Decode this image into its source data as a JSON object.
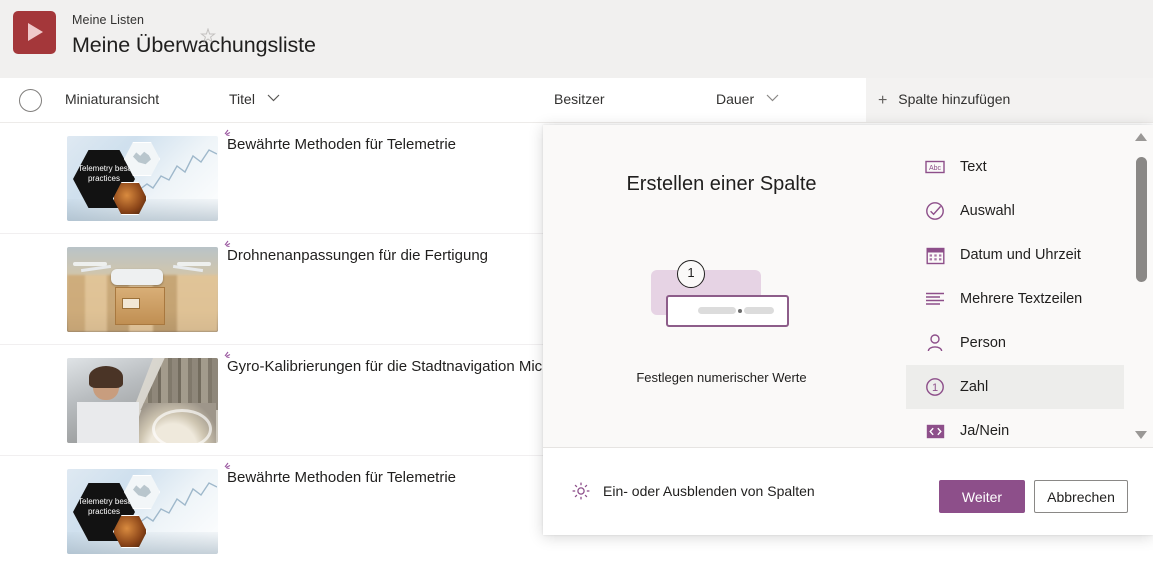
{
  "header": {
    "app_icon": "video-play-icon",
    "breadcrumb": "Meine Listen",
    "title": "Meine Überwachungsliste",
    "brand_color": "#a4373a"
  },
  "columns": {
    "select_all": "select-all-circle",
    "thumbnail": "Miniaturansicht",
    "title": "Titel",
    "owner": "Besitzer",
    "duration": "Dauer",
    "add_column": "Spalte hinzufügen",
    "add_column_icon": "plus-icon"
  },
  "rows": [
    {
      "title": "Bewährte Methoden für Telemetrie",
      "thumb_kind": "telemetry",
      "thumb_text": "Telemetry best practices"
    },
    {
      "title": "Drohnenanpassungen für die Fertigung",
      "thumb_kind": "drone",
      "thumb_text": ""
    },
    {
      "title": "Gyro-Kalibrierungen für die Stadtnavigation Micro",
      "thumb_kind": "gyro",
      "thumb_text": ""
    },
    {
      "title": "Bewährte Methoden für Telemetrie",
      "thumb_kind": "telemetry",
      "thumb_text": "Telemetry best practices"
    }
  ],
  "dialog": {
    "heading": "Erstellen einer Spalte",
    "illustration": {
      "badge": "1",
      "caption": "Festlegen numerischer Werte"
    },
    "accent_color": "#8d4f8a",
    "types": [
      {
        "label": "Text",
        "icon": "abc-text-icon",
        "selected": false
      },
      {
        "label": "Auswahl",
        "icon": "check-circle-icon",
        "selected": false
      },
      {
        "label": "Datum und Uhrzeit",
        "icon": "calendar-icon",
        "selected": false
      },
      {
        "label": "Mehrere Textzeilen",
        "icon": "multiline-text-icon",
        "selected": false
      },
      {
        "label": "Person",
        "icon": "person-icon",
        "selected": false
      },
      {
        "label": "Zahl",
        "icon": "number-one-circle-icon",
        "selected": true
      },
      {
        "label": "Ja/Nein",
        "icon": "toggle-yes-no-icon",
        "selected": false
      }
    ],
    "footer": {
      "show_hide_columns": "Ein- oder Ausblenden von Spalten",
      "show_hide_icon": "gear-icon",
      "primary_button": "Weiter",
      "secondary_button": "Abbrechen"
    }
  }
}
